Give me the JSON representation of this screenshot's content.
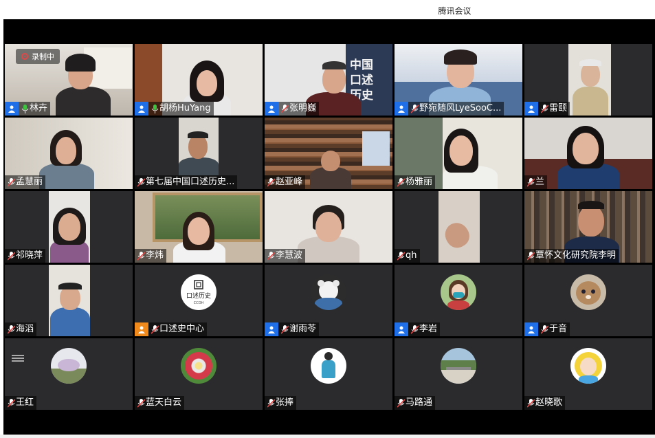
{
  "window": {
    "title": "腾讯会议"
  },
  "recording": {
    "label": "录制中"
  },
  "participants": [
    {
      "name": "林卉",
      "user_icon": true,
      "mic": "active"
    },
    {
      "name": "胡杨HuYang",
      "user_icon": true,
      "mic": "active"
    },
    {
      "name": "张明巍",
      "user_icon": true,
      "mic": "muted"
    },
    {
      "name": "野宛随风LyeSooC...",
      "user_icon": true,
      "mic": "muted"
    },
    {
      "name": "雷颐",
      "user_icon": true,
      "mic": "muted"
    },
    {
      "name": "孟慧丽",
      "mic": "muted"
    },
    {
      "name": "第七届中国口述历史...",
      "mic": "muted"
    },
    {
      "name": "赵亚峰",
      "mic": "muted"
    },
    {
      "name": "杨雅丽",
      "mic": "muted"
    },
    {
      "name": "兰",
      "mic": "muted"
    },
    {
      "name": "祁晓萍",
      "mic": "muted"
    },
    {
      "name": "李炜",
      "mic": "muted"
    },
    {
      "name": "李慧波",
      "mic": "muted"
    },
    {
      "name": "qh",
      "mic": "muted"
    },
    {
      "name": "覃怀文化研究院李明",
      "mic": "muted"
    },
    {
      "name": "海滔",
      "mic": "muted"
    },
    {
      "name": "口述史中心",
      "user_icon": true,
      "mic": "muted",
      "avatar_text": "口述历史",
      "avatar_subtext": "CCOH"
    },
    {
      "name": "谢雨苓",
      "user_icon": true,
      "mic": "muted"
    },
    {
      "name": "李岩",
      "user_icon": true,
      "mic": "muted"
    },
    {
      "name": "于音",
      "user_icon": true,
      "mic": "muted"
    },
    {
      "name": "王红",
      "mic": "muted"
    },
    {
      "name": "蓝天白云",
      "mic": "muted"
    },
    {
      "name": "张捧",
      "mic": "muted"
    },
    {
      "name": "马路通",
      "mic": "muted"
    },
    {
      "name": "赵晓歌",
      "mic": "muted"
    }
  ],
  "colors": {
    "accent": "#1e6fe8",
    "speaking": "#3ec43e",
    "muted": "#e04848",
    "tile_bg": "#2b2b2e"
  }
}
